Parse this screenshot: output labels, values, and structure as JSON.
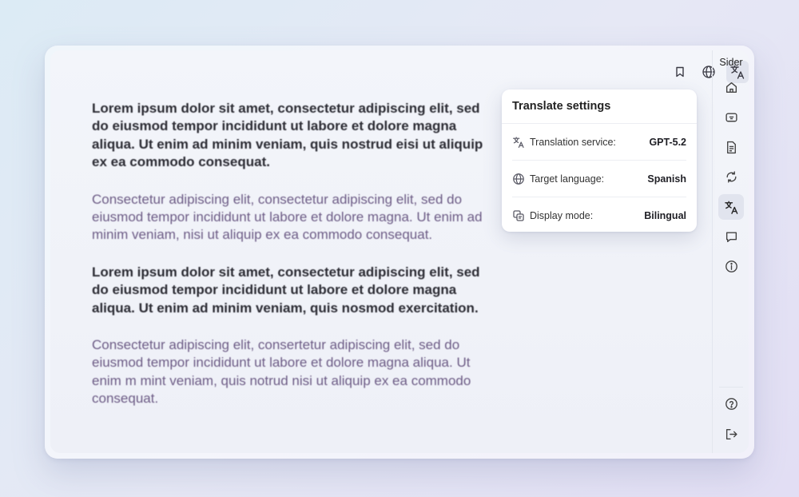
{
  "reader": {
    "paragraphs": [
      {
        "kind": "original",
        "text": "Lorem ipsum dolor sit amet, consectetur adipiscing elit, sed do eiusmod tempor incididunt ut labore et dolore magna aliqua. Ut enim ad minim veniam, quis nostrud eisi ut aliquip ex ea commodo consequat."
      },
      {
        "kind": "translated",
        "text": "Consectetur adipiscing elit, consectetur adipiscing elit, sed do  eiusmod tempor incididunt ut labore et dolore magna. Ut enim ad minim veniam,  nisi ut aliquip ex ea commodo consequat."
      },
      {
        "kind": "original",
        "text": "Lorem ipsum dolor sit amet, consectetur adipiscing elit, sed do eiusmod tempor incididunt ut labore et dolore magna aliqua. Ut enim ad minim veniam, quis nosmod  exercitation."
      },
      {
        "kind": "translated",
        "text": "Consectetur adipiscing elit, consertetur adipiscing elit, sed do eiusmod tempor incididunt ut labore et dolore magna aliqua. Ut enim m mint veniam, quis notrud nisi ut aliquip ex ea commodo consequat."
      }
    ]
  },
  "toolbar": {
    "icons": [
      "bookmark-icon",
      "globe-icon",
      "translate-icon"
    ],
    "active": "translate-icon"
  },
  "translate_settings": {
    "title": "Translate settings",
    "rows": [
      {
        "icon": "translate-icon",
        "label": "Translation service:",
        "value": "GPT-5.2"
      },
      {
        "icon": "globe-icon",
        "label": "Target language:",
        "value": "Spanish"
      },
      {
        "icon": "display-mode-icon",
        "label": "Display mode:",
        "value": "Bilingual"
      }
    ]
  },
  "sidebar": {
    "title": "Sider",
    "items": [
      "home-icon",
      "chat-icon",
      "document-icon",
      "refresh-icon",
      "translate-icon",
      "message-icon",
      "info-icon"
    ],
    "active": "translate-icon",
    "bottom_items": [
      "help-icon",
      "logout-icon"
    ]
  },
  "colors": {
    "original_text": "#2b2b33",
    "translated_text": "#6c5b85",
    "active_button_bg": "#e1e4ee"
  }
}
